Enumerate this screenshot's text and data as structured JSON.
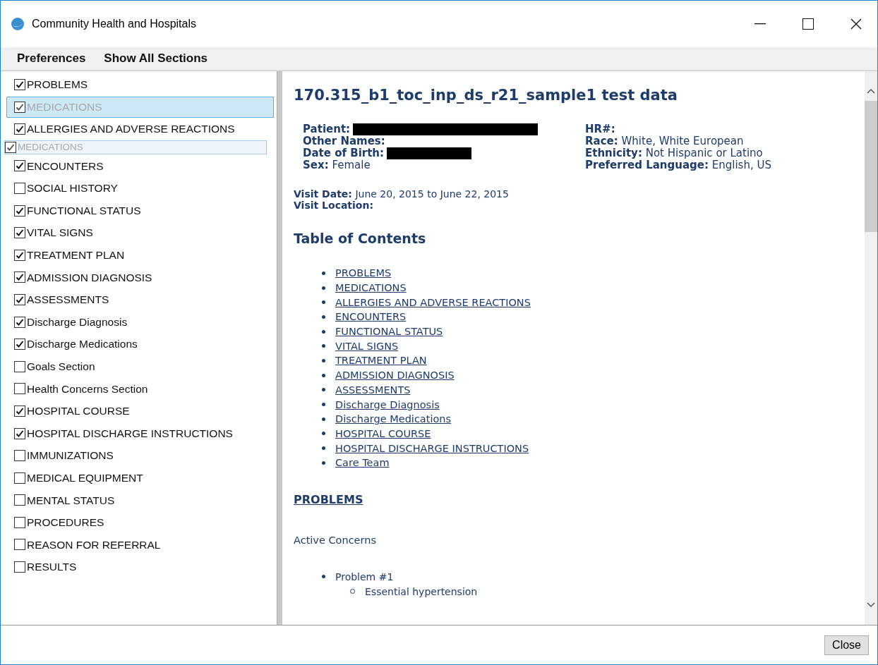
{
  "window": {
    "title": "Community Health and Hospitals"
  },
  "menu": [
    "Preferences",
    "Show All Sections"
  ],
  "sections": [
    {
      "label": "PROBLEMS",
      "checked": true,
      "selected": false
    },
    {
      "label": "MEDICATIONS",
      "checked": true,
      "selected": true
    },
    {
      "label": "ALLERGIES AND ADVERSE REACTIONS",
      "checked": true,
      "selected": false
    },
    {
      "kind": "drag_ghost",
      "label": "MEDICATIONS",
      "checked": true,
      "selected": false
    },
    {
      "label": "ENCOUNTERS",
      "checked": true,
      "selected": false
    },
    {
      "label": "SOCIAL HISTORY",
      "checked": false,
      "selected": false
    },
    {
      "label": "FUNCTIONAL STATUS",
      "checked": true,
      "selected": false
    },
    {
      "label": "VITAL SIGNS",
      "checked": true,
      "selected": false
    },
    {
      "label": "TREATMENT PLAN",
      "checked": true,
      "selected": false
    },
    {
      "label": "ADMISSION DIAGNOSIS",
      "checked": true,
      "selected": false
    },
    {
      "label": "ASSESSMENTS",
      "checked": true,
      "selected": false
    },
    {
      "label": "Discharge Diagnosis",
      "checked": true,
      "selected": false
    },
    {
      "label": "Discharge Medications",
      "checked": true,
      "selected": false
    },
    {
      "label": "Goals Section",
      "checked": false,
      "selected": false
    },
    {
      "label": "Health Concerns Section",
      "checked": false,
      "selected": false
    },
    {
      "label": "HOSPITAL COURSE",
      "checked": true,
      "selected": false
    },
    {
      "label": "HOSPITAL DISCHARGE INSTRUCTIONS",
      "checked": true,
      "selected": false
    },
    {
      "label": "IMMUNIZATIONS",
      "checked": false,
      "selected": false
    },
    {
      "label": "MEDICAL EQUIPMENT",
      "checked": false,
      "selected": false
    },
    {
      "label": "MENTAL STATUS",
      "checked": false,
      "selected": false
    },
    {
      "label": "PROCEDURES",
      "checked": false,
      "selected": false
    },
    {
      "label": "REASON FOR REFERRAL",
      "checked": false,
      "selected": false
    },
    {
      "label": "RESULTS",
      "checked": false,
      "selected": false
    }
  ],
  "document": {
    "title": "170.315_b1_toc_inp_ds_r21_sample1 test data",
    "left_fields": [
      {
        "label": "Patient:",
        "redacted": true
      },
      {
        "label": "Other Names:"
      },
      {
        "label": "Date of Birth:",
        "redacted": true
      },
      {
        "label": "Sex:",
        "value": "Female"
      }
    ],
    "right_fields": [
      {
        "label": "HR#:"
      },
      {
        "label": "Race:",
        "value": "White, White European"
      },
      {
        "label": "Ethnicity:",
        "value": "Not Hispanic or Latino"
      },
      {
        "label": "Preferred Language:",
        "value": "English, US"
      }
    ],
    "visit": [
      {
        "label": "Visit Date:",
        "value": "June 20, 2015 to June 22, 2015"
      },
      {
        "label": "Visit Location:"
      }
    ],
    "toc_title": "Table of Contents",
    "toc": [
      "PROBLEMS",
      "MEDICATIONS",
      "ALLERGIES AND ADVERSE REACTIONS",
      "ENCOUNTERS",
      "FUNCTIONAL STATUS",
      "VITAL SIGNS",
      "TREATMENT PLAN",
      "ADMISSION DIAGNOSIS",
      "ASSESSMENTS",
      "Discharge Diagnosis",
      "Discharge Medications",
      "HOSPITAL COURSE",
      "HOSPITAL DISCHARGE INSTRUCTIONS",
      "Care Team"
    ],
    "section_heading": "PROBLEMS",
    "subheading": "Active Concerns",
    "problems": [
      {
        "label": "Problem #1",
        "children": [
          "Essential hypertension"
        ]
      }
    ]
  },
  "buttons": [
    "Close"
  ]
}
